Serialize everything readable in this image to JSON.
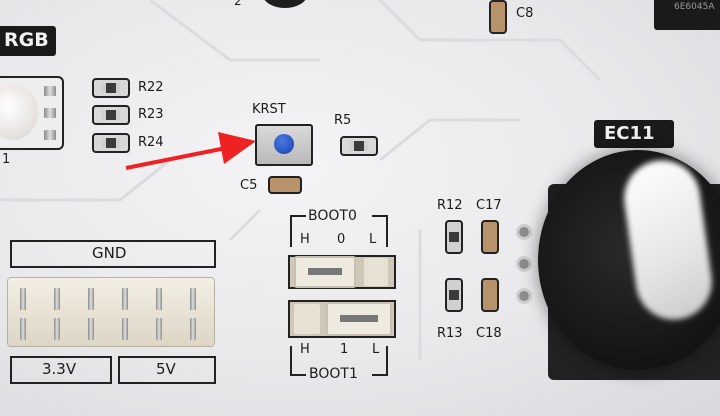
{
  "labels": {
    "rgb": "RGB",
    "r22": "R22",
    "r23": "R23",
    "r24": "R24",
    "krst": "KRST",
    "r5": "R5",
    "c5": "C5",
    "c8": "C8",
    "gnd": "GND",
    "v33": "3.3V",
    "v5": "5V",
    "boot0": "BOOT0",
    "boot0_h": "H",
    "boot0_0": "0",
    "boot0_l": "L",
    "boot1": "BOOT1",
    "boot1_h": "H",
    "boot1_1": "1",
    "boot1_l": "L",
    "r12": "R12",
    "c17": "C17",
    "r13": "R13",
    "c18": "C18",
    "ec11": "EC11",
    "chip_text": "6E6045A",
    "edge_fragment": "1",
    "top_fragment": "2"
  },
  "colors": {
    "pcb": "#ececef",
    "silkscreen": "#1c1c1c",
    "arrow": "#ee2222",
    "button_cap": "#2b57c4",
    "knob": "#161616"
  }
}
